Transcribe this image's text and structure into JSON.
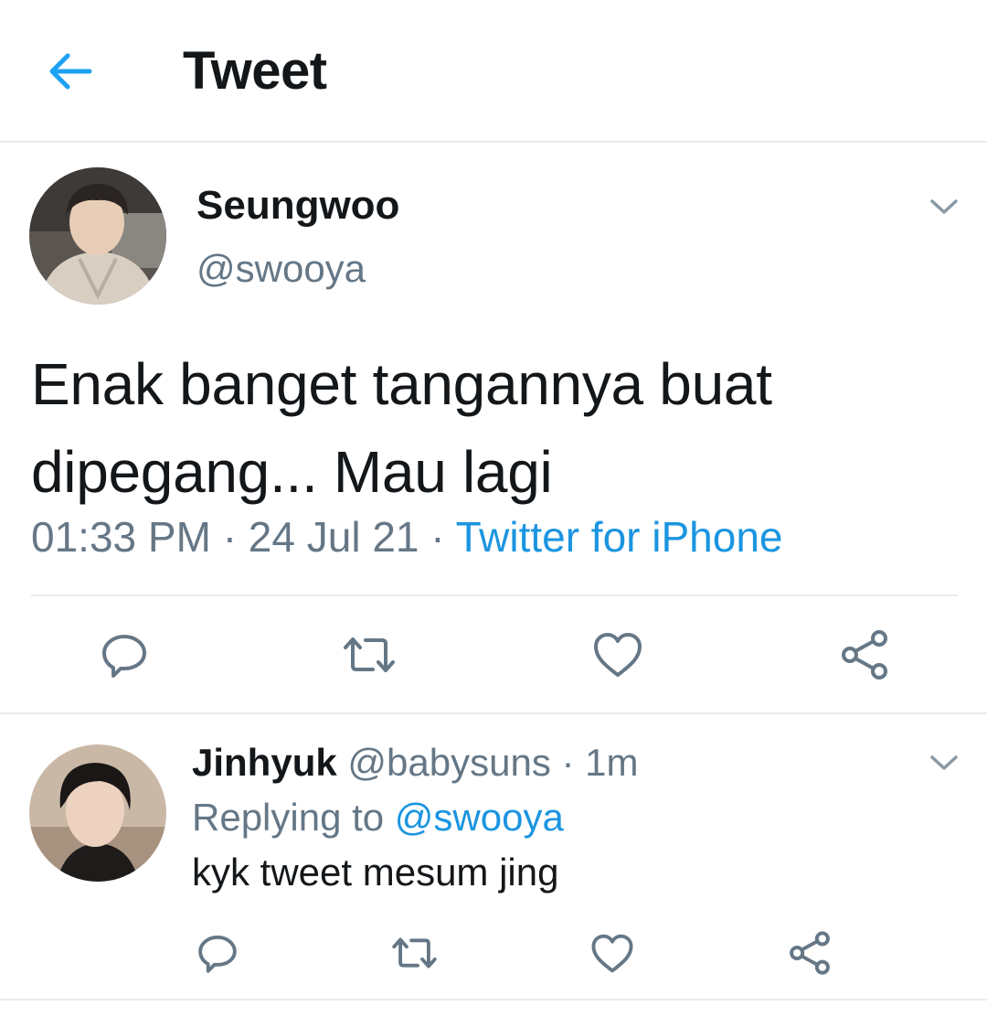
{
  "header": {
    "title": "Tweet",
    "back_icon": "arrow-left-icon",
    "accent": "#1da1f2"
  },
  "tweet": {
    "author": {
      "name": "Seungwoo",
      "handle": "@swooya"
    },
    "text": "Enak banget tangannya buat dipegang... Mau lagi",
    "time": "01:33 PM",
    "separator": "·",
    "date": "24 Jul 21",
    "source": "Twitter for iPhone",
    "source_color": "#1b95e0",
    "actions": [
      "reply-icon",
      "retweet-icon",
      "like-icon",
      "share-icon"
    ]
  },
  "reply": {
    "author": {
      "name": "Jinhyuk",
      "handle": "@babysuns"
    },
    "separator": "·",
    "age": "1m",
    "replying_label": "Replying to",
    "replying_to": "@swooya",
    "text": "kyk tweet mesum jing",
    "actions": [
      "reply-icon",
      "retweet-icon",
      "like-icon",
      "share-icon"
    ]
  },
  "colors": {
    "text_primary": "#14171a",
    "text_secondary": "#657786",
    "icon": "#657786",
    "divider": "#e6ecf0"
  }
}
